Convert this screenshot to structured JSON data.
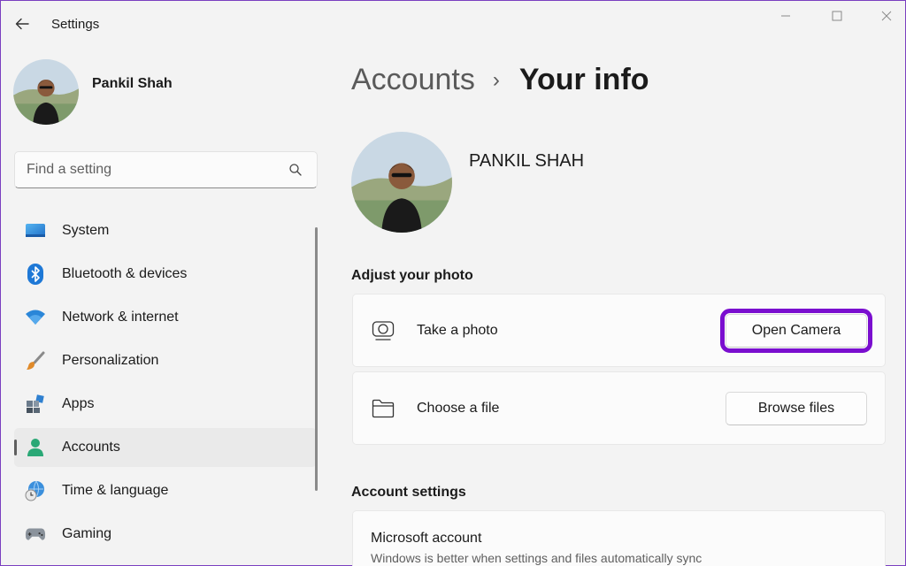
{
  "window": {
    "title": "Settings",
    "controls": [
      "minimize",
      "maximize",
      "close"
    ]
  },
  "profile": {
    "name": "Pankil Shah"
  },
  "search": {
    "placeholder": "Find a setting"
  },
  "sidebar": {
    "items": [
      {
        "label": "System",
        "icon": "monitor-icon",
        "active": false
      },
      {
        "label": "Bluetooth & devices",
        "icon": "bluetooth-icon",
        "active": false
      },
      {
        "label": "Network & internet",
        "icon": "wifi-icon",
        "active": false
      },
      {
        "label": "Personalization",
        "icon": "paintbrush-icon",
        "active": false
      },
      {
        "label": "Apps",
        "icon": "apps-icon",
        "active": false
      },
      {
        "label": "Accounts",
        "icon": "person-icon",
        "active": true
      },
      {
        "label": "Time & language",
        "icon": "globe-clock-icon",
        "active": false
      },
      {
        "label": "Gaming",
        "icon": "gamepad-icon",
        "active": false
      }
    ]
  },
  "header": {
    "parent": "Accounts",
    "separator": "›",
    "current": "Your info"
  },
  "user": {
    "display_name": "PANKIL SHAH"
  },
  "adjust_photo": {
    "title": "Adjust your photo",
    "take_photo": {
      "label": "Take a photo",
      "button": "Open Camera",
      "icon": "camera-icon"
    },
    "choose_file": {
      "label": "Choose a file",
      "button": "Browse files",
      "icon": "folder-icon"
    }
  },
  "account_settings": {
    "title": "Account settings",
    "microsoft_account": {
      "title": "Microsoft account",
      "description": "Windows is better when settings and files automatically sync"
    }
  },
  "colors": {
    "accent": "#7a0ecf",
    "background": "#f3f3f3",
    "card": "#fbfbfb"
  }
}
